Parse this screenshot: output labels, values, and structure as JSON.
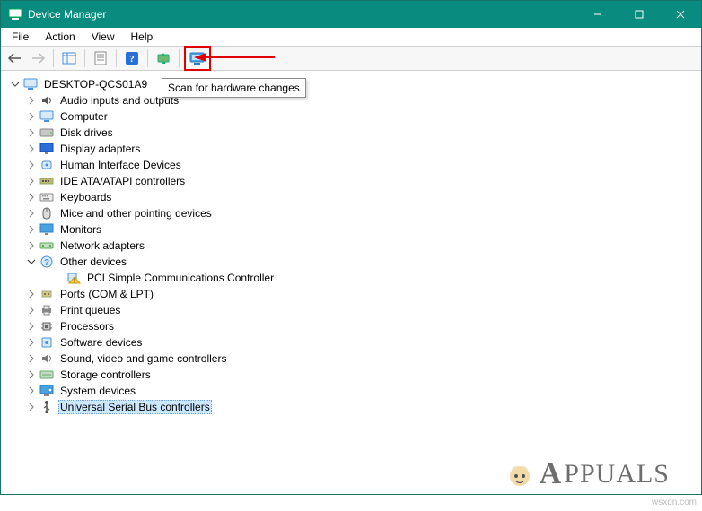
{
  "window": {
    "title": "Device Manager"
  },
  "menu": {
    "file": "File",
    "action": "Action",
    "view": "View",
    "help": "Help"
  },
  "toolbar": {
    "back": "Back",
    "forward": "Forward",
    "show_hide": "Show/Hide Console Tree",
    "properties": "Properties",
    "help": "Help",
    "update": "Update Driver",
    "scan": "Scan for hardware changes"
  },
  "tooltip": {
    "scan": "Scan for hardware changes"
  },
  "tree": {
    "root": "DESKTOP-QCS01A9",
    "items": [
      {
        "label": "Audio inputs and outputs",
        "icon": "speaker-icon",
        "expanded": false
      },
      {
        "label": "Computer",
        "icon": "computer-icon",
        "expanded": false
      },
      {
        "label": "Disk drives",
        "icon": "disk-icon",
        "expanded": false
      },
      {
        "label": "Display adapters",
        "icon": "display-icon",
        "expanded": false
      },
      {
        "label": "Human Interface Devices",
        "icon": "hid-icon",
        "expanded": false
      },
      {
        "label": "IDE ATA/ATAPI controllers",
        "icon": "ide-icon",
        "expanded": false
      },
      {
        "label": "Keyboards",
        "icon": "keyboard-icon",
        "expanded": false
      },
      {
        "label": "Mice and other pointing devices",
        "icon": "mouse-icon",
        "expanded": false
      },
      {
        "label": "Monitors",
        "icon": "monitor-icon",
        "expanded": false
      },
      {
        "label": "Network adapters",
        "icon": "network-icon",
        "expanded": false
      },
      {
        "label": "Other devices",
        "icon": "other-icon",
        "expanded": true,
        "children": [
          {
            "label": "PCI Simple Communications Controller",
            "icon": "warning-icon"
          }
        ]
      },
      {
        "label": "Ports (COM & LPT)",
        "icon": "port-icon",
        "expanded": false
      },
      {
        "label": "Print queues",
        "icon": "printer-icon",
        "expanded": false
      },
      {
        "label": "Processors",
        "icon": "cpu-icon",
        "expanded": false
      },
      {
        "label": "Software devices",
        "icon": "software-icon",
        "expanded": false
      },
      {
        "label": "Sound, video and game controllers",
        "icon": "sound-icon",
        "expanded": false
      },
      {
        "label": "Storage controllers",
        "icon": "storage-icon",
        "expanded": false
      },
      {
        "label": "System devices",
        "icon": "system-icon",
        "expanded": false
      },
      {
        "label": "Universal Serial Bus controllers",
        "icon": "usb-icon",
        "expanded": false,
        "selected": true
      }
    ]
  },
  "watermark": "wsxdn.com",
  "brand": "PPUALS"
}
